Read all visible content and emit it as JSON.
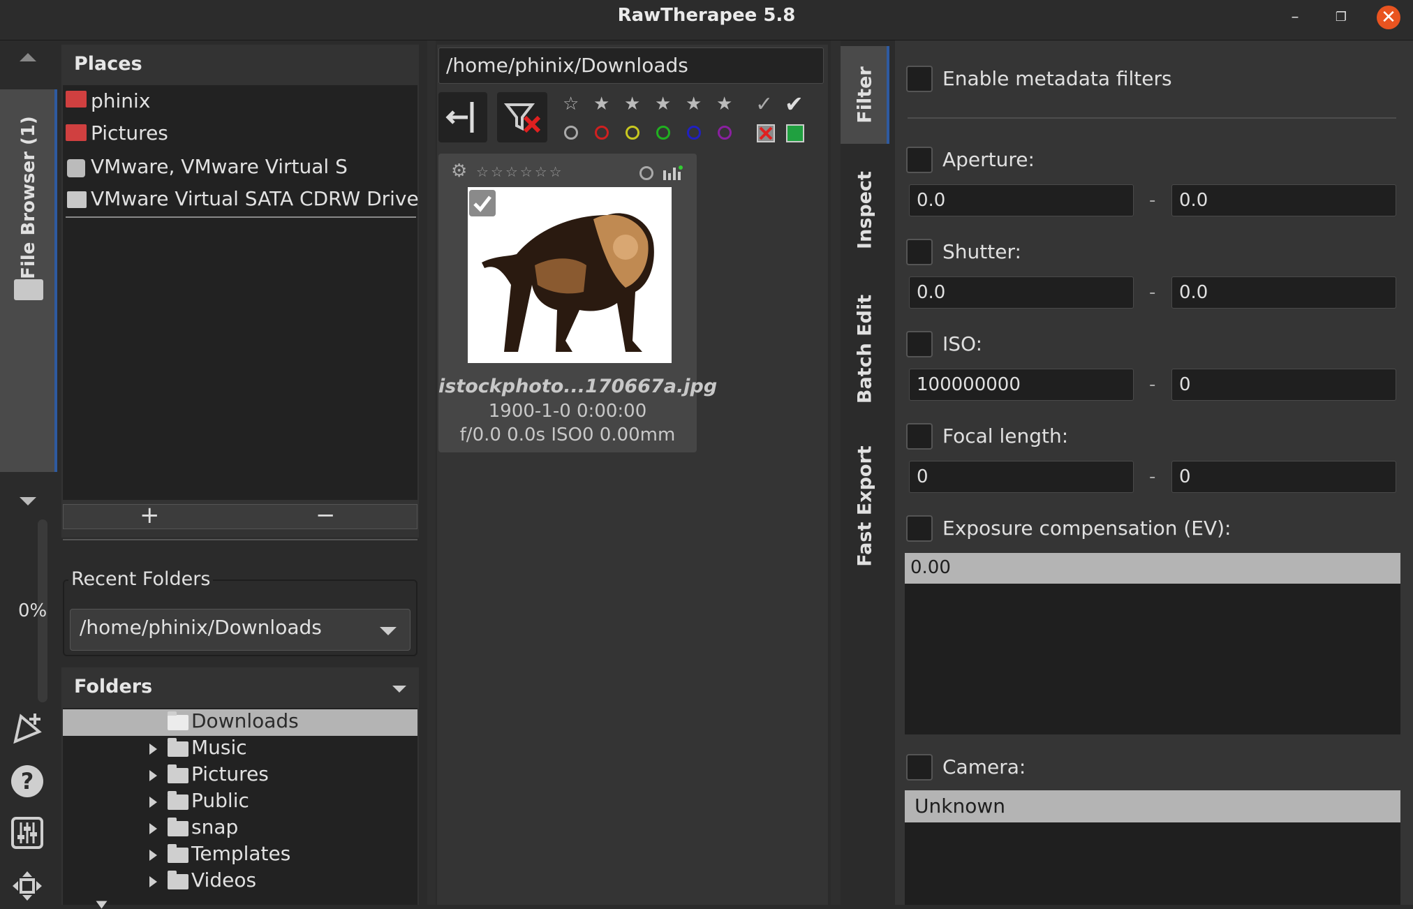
{
  "window": {
    "title": "RawTherapee 5.8"
  },
  "left_toolbar": {
    "file_browser_tab": "File Browser (1)",
    "progress": "0%"
  },
  "places": {
    "header": "Places",
    "items": [
      "phinix",
      "Pictures",
      "VMware, VMware Virtual S",
      "VMware Virtual SATA CDRW Drive"
    ],
    "add_label": "+",
    "remove_label": "−"
  },
  "recent": {
    "header": "Recent Folders",
    "selected": "/home/phinix/Downloads"
  },
  "folders": {
    "header": "Folders",
    "items": [
      "Downloads",
      "Music",
      "Pictures",
      "Public",
      "snap",
      "Templates",
      "Videos"
    ]
  },
  "browser": {
    "path": "/home/phinix/Downloads",
    "thumbnail": {
      "filename": "istockphoto...170667a.jpg",
      "date": "1900-1-0 0:00:00",
      "exif": "f/0.0 0.0s ISO0 0.00mm"
    }
  },
  "side_tabs": {
    "filter": "Filter",
    "inspect": "Inspect",
    "batch_edit": "Batch Edit",
    "fast_export": "Fast Export"
  },
  "filter": {
    "enable_label": "Enable metadata filters",
    "aperture_label": "Aperture:",
    "aperture_min": "0.0",
    "aperture_max": "0.0",
    "shutter_label": "Shutter:",
    "shutter_min": "0.0",
    "shutter_max": "0.0",
    "iso_label": "ISO:",
    "iso_min": "100000000",
    "iso_max": "0",
    "focal_label": "Focal length:",
    "focal_min": "0",
    "focal_max": "0",
    "ev_label": "Exposure compensation (EV):",
    "ev_value": "0.00",
    "camera_label": "Camera:",
    "camera_value": "Unknown",
    "dash": "-"
  },
  "colors": {
    "accent": "#2e5aa0",
    "close": "#e95420",
    "red": "#d02020",
    "yellow": "#c8c820",
    "green": "#20b020",
    "blue": "#2020c0",
    "purple": "#8a20a0"
  }
}
